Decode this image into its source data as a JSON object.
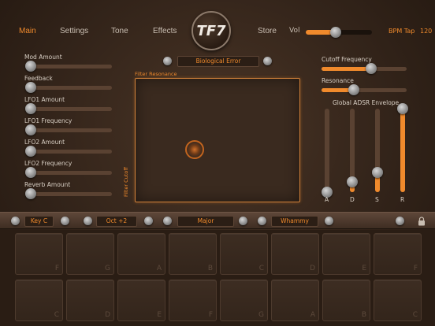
{
  "nav": {
    "items": [
      {
        "label": "Main",
        "active": true
      },
      {
        "label": "Settings",
        "active": false
      },
      {
        "label": "Tone",
        "active": false
      },
      {
        "label": "Effects",
        "active": false
      },
      {
        "label": "Store",
        "active": false
      }
    ],
    "logo_text": "TF7",
    "vol_label": "Vol",
    "vol_value": 0.45,
    "bpm_label": "BPM Tap",
    "bpm_value": "120"
  },
  "left_sliders": [
    {
      "label": "Mod Amount",
      "value": 0.0
    },
    {
      "label": "Feedback",
      "value": 0.0
    },
    {
      "label": "LFO1 Amount",
      "value": 0.0
    },
    {
      "label": "LFO1 Frequency",
      "value": 0.0
    },
    {
      "label": "LFO2 Amount",
      "value": 0.0
    },
    {
      "label": "LFO2 Frequency",
      "value": 0.0
    },
    {
      "label": "Reverb Amount",
      "value": 0.0
    }
  ],
  "center": {
    "preset_name": "Biological Error",
    "xy_x_label": "Filter Resonance",
    "xy_y_label": "Filter Cutoff",
    "xy_x": 0.36,
    "xy_y": 0.42
  },
  "right": {
    "cutoff_label": "Cutoff Frequency",
    "cutoff_value": 0.58,
    "resonance_label": "Resonance",
    "resonance_value": 0.38,
    "adsr_title": "Global ADSR Envelope",
    "adsr": [
      {
        "label": "A",
        "value": 0.0
      },
      {
        "label": "D",
        "value": 0.12
      },
      {
        "label": "S",
        "value": 0.24
      },
      {
        "label": "R",
        "value": 1.0
      }
    ]
  },
  "keybar": {
    "key": "Key C",
    "octave": "Oct +2",
    "scale": "Major",
    "effect": "Whammy"
  },
  "pads": {
    "top_row": [
      "F",
      "G",
      "A",
      "B",
      "C",
      "D",
      "E",
      "F"
    ],
    "bottom_row": [
      "C",
      "D",
      "E",
      "F",
      "G",
      "A",
      "B",
      "C"
    ]
  },
  "colors": {
    "accent": "#f08a2c",
    "background": "#33241a"
  }
}
